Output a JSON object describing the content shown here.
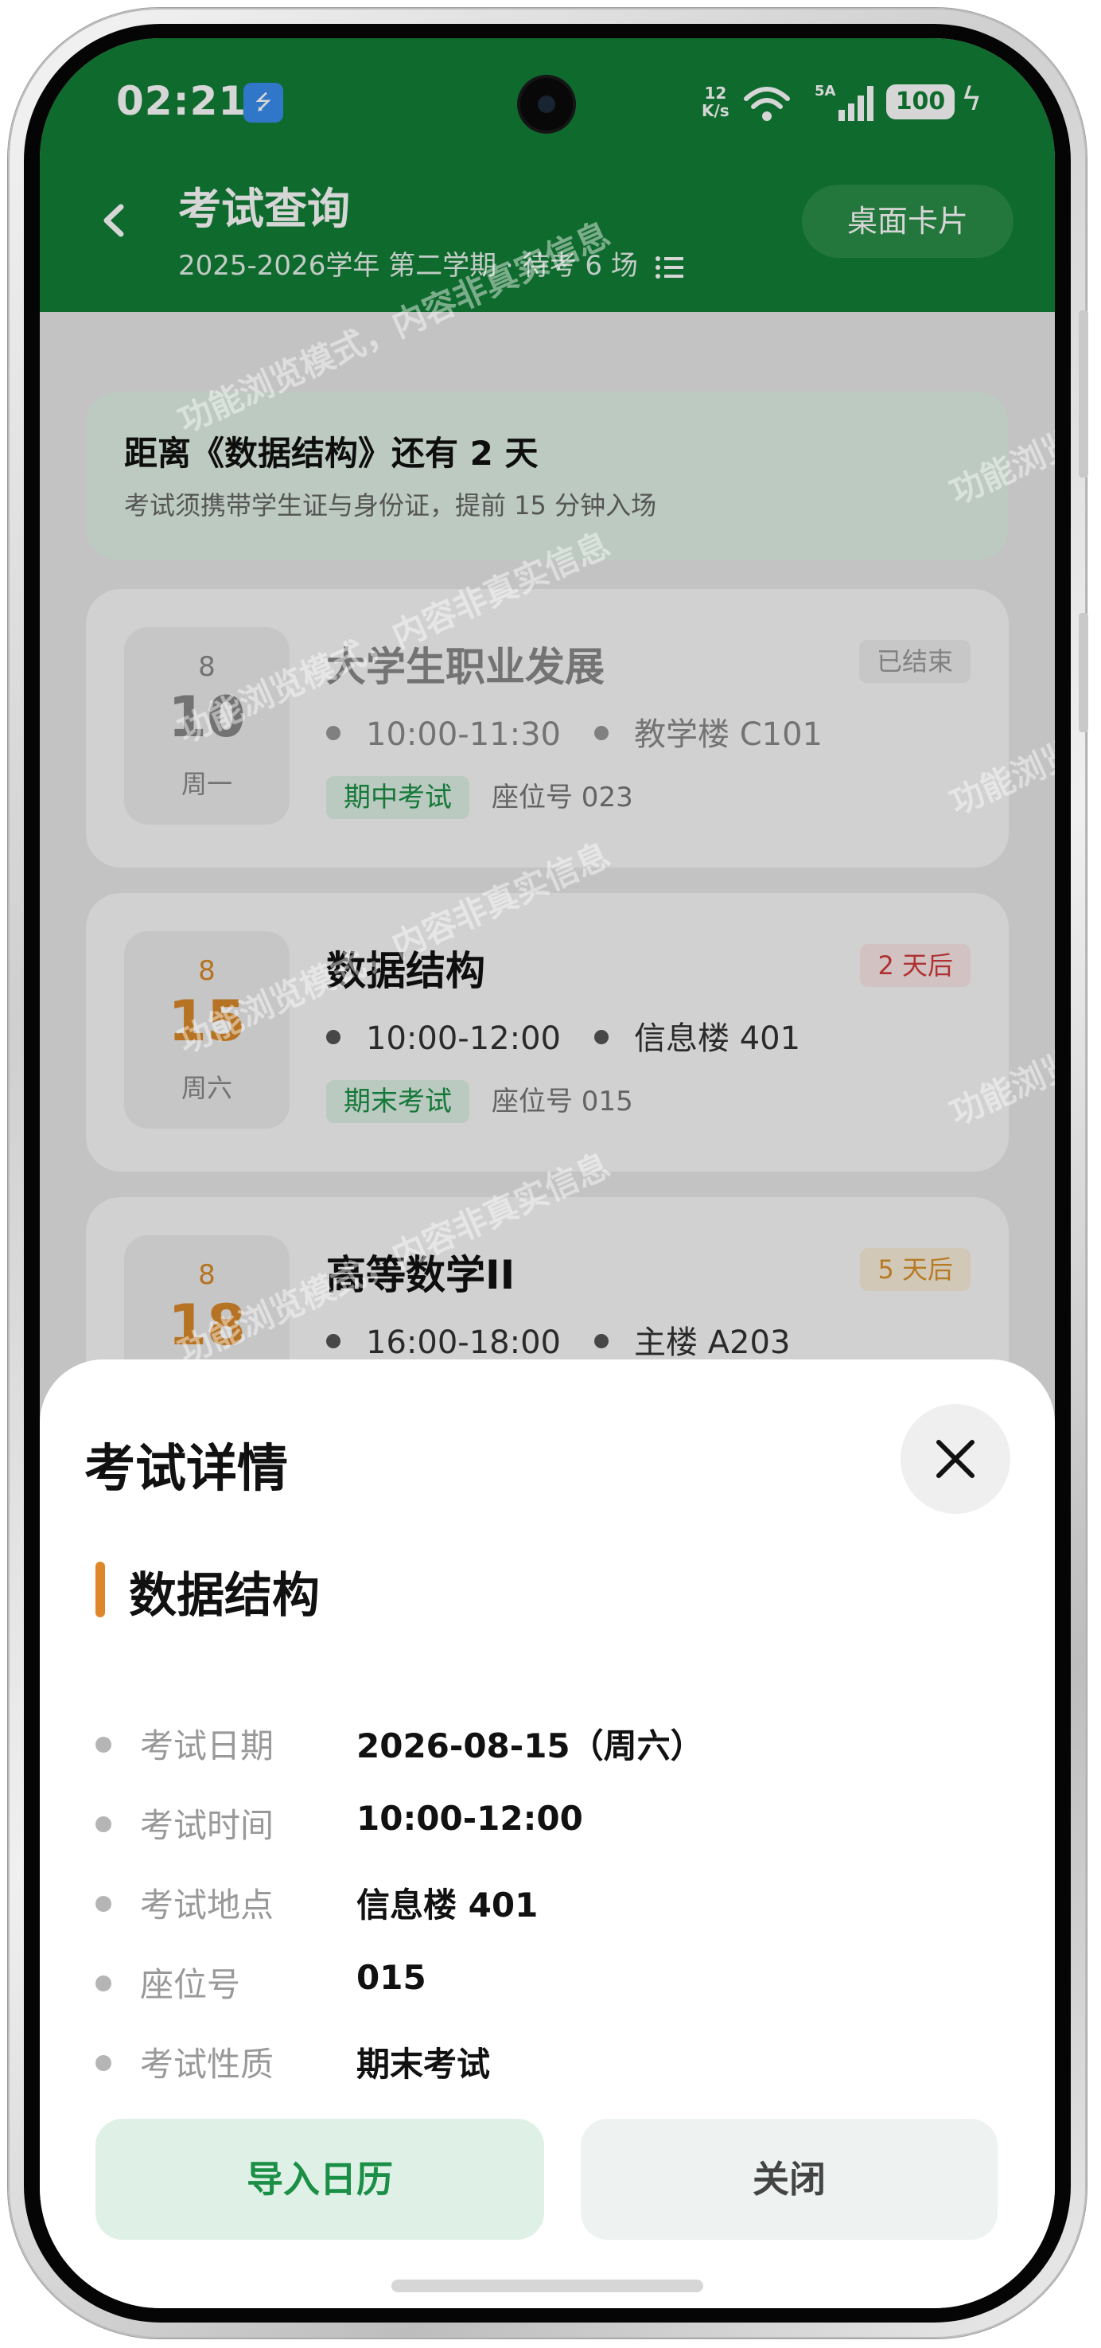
{
  "status": {
    "time": "02:21",
    "net_speed": "12\nK/s",
    "battery": "100"
  },
  "header": {
    "title": "考试查询",
    "term": "2025-2026学年 第二学期",
    "separator": " · ",
    "pending": "待考 6 场",
    "card_button": "桌面卡片"
  },
  "notice": {
    "title": "距离《数据结构》还有 2 天",
    "subtitle": "考试须携带学生证与身份证，提前 15 分钟入场"
  },
  "exams": [
    {
      "month": "8",
      "day": "10",
      "weekday": "周一",
      "name": "大学生职业发展",
      "time": "10:00-11:30",
      "location": "教学楼 C101",
      "type": "期中考试",
      "seat": "座位号 023",
      "badge": "已结束",
      "badge_color": "#9a9a9a",
      "badge_bg": "#eeeeee"
    },
    {
      "month": "8",
      "day": "15",
      "weekday": "周六",
      "name": "数据结构",
      "time": "10:00-12:00",
      "location": "信息楼 401",
      "type": "期末考试",
      "seat": "座位号 015",
      "badge": "2 天后",
      "badge_color": "#d23b3b",
      "badge_bg": "#fbe7e7"
    },
    {
      "month": "8",
      "day": "18",
      "weekday": "",
      "name": "高等数学II",
      "time": "16:00-18:00",
      "location": "主楼 A203",
      "badge": "5 天后",
      "badge_color": "#d9932a",
      "badge_bg": "#fbefdc"
    }
  ],
  "watermark": "功能浏览模式，内容非真实信息",
  "sheet": {
    "title": "考试详情",
    "course": "数据结构",
    "rows": [
      {
        "label": "考试日期",
        "value": "2026-08-15（周六）"
      },
      {
        "label": "考试时间",
        "value": "10:00-12:00"
      },
      {
        "label": "考试地点",
        "value": "信息楼 401"
      },
      {
        "label": "座位号",
        "value": "015"
      },
      {
        "label": "考试性质",
        "value": "期末考试"
      }
    ],
    "import_button": "导入日历",
    "close_button": "关闭"
  },
  "colors": {
    "brand": "#127f36",
    "accent": "#e0862a",
    "green_text": "#1a8f45"
  }
}
